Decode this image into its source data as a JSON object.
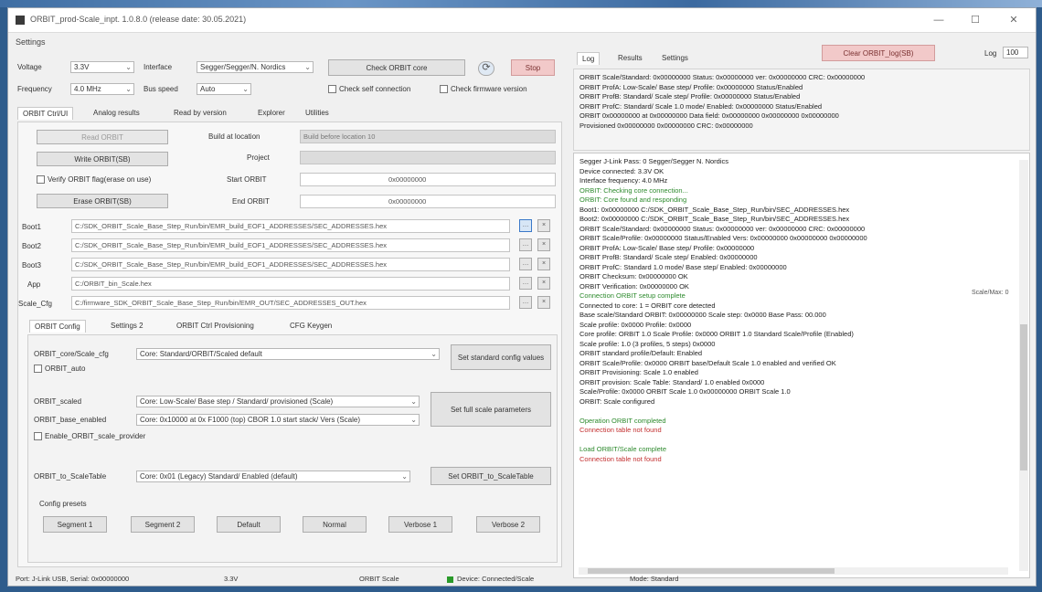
{
  "window": {
    "title": "ORBIT_prod-Scale_inpt. 1.0.8.0 (release date: 30.05.2021)",
    "controls": [
      "—",
      "☐",
      "✕"
    ]
  },
  "menu": {
    "settings": "Settings"
  },
  "top_controls": {
    "voltage_label": "Voltage",
    "voltage_value": "3.3V",
    "interface_label": "Interface",
    "interface_value": "Segger/Segger/N. Nordics",
    "frequency_label": "Frequency",
    "frequency_value": "4.0 MHz",
    "speed_label": "Bus speed",
    "speed_value": "Auto",
    "connect_button": "Check ORBIT core",
    "stop_button": "Stop",
    "refresh_icon": "refresh-icon",
    "check_a": "Check self connection",
    "check_b": "Check firmware version"
  },
  "tabs_main": [
    "ORBIT Ctrl/UI",
    "Analog results",
    "Read by version",
    "Explorer",
    "Utilities"
  ],
  "flash": {
    "read_button": "Read ORBIT",
    "write_button": "Write ORBIT(SB)",
    "verify_checkbox": "Verify ORBIT flag(erase on use)",
    "erase_button": "Erase ORBIT(SB)",
    "build_label": "Build at location",
    "build_value": "Build before location 10",
    "project_label": "Project",
    "start_label": "Start ORBIT",
    "start_value": "0x00000000",
    "end_label": "End ORBIT",
    "end_value": "0x00000000"
  },
  "files": [
    {
      "label": "Boot1",
      "value": "C:/SDK_ORBIT_Scale_Base_Step_Run/bin/EMR_build_EOF1_ADDRESSES/SEC_ADDRESSES.hex"
    },
    {
      "label": "Boot2",
      "value": "C:/SDK_ORBIT_Scale_Base_Step_Run/bin/EMR_build_EOF1_ADDRESSES/SEC_ADDRESSES.hex"
    },
    {
      "label": "Boot3",
      "value": "C:/SDK_ORBIT_Scale_Base_Step_Run/bin/EMR_build_EOF1_ADDRESSES/SEC_ADDRESSES.hex"
    },
    {
      "label": "App",
      "value": "C:/ORBIT_bin_Scale.hex"
    },
    {
      "label": "Scale_Cfg",
      "value": "C:/firmware_SDK_ORBIT_Scale_Base_Step_Run/bin/EMR_OUT/SEC_ADDRESSES_OUT.hex"
    }
  ],
  "tabs_config": [
    "ORBIT Config",
    "Settings 2",
    "ORBIT Ctrl Provisioning",
    "CFG Keygen"
  ],
  "config": {
    "row1_label": "ORBIT_core/Scale_cfg",
    "row1_value": "Core: Standard/ORBIT/Scaled default",
    "row1_check": "ORBIT_auto",
    "row1_button": "Set standard config values",
    "row2_label": "ORBIT_scaled",
    "row2_value": "Core: Low-Scale/ Base step / Standard/ provisioned (Scale)",
    "row3_label": "ORBIT_base_enabled",
    "row3_value": "Core: 0x10000 at 0x F1000 (top) CBOR 1.0 start stack/ Vers (Scale)",
    "row3_check": "Enable_ORBIT_scale_provider",
    "row23_button": "Set full scale parameters",
    "row4_label": "ORBIT_to_ScaleTable",
    "row4_value": "Core: 0x01 (Legacy) Standard/ Enabled (default)",
    "row4_button": "Set ORBIT_to_ScaleTable"
  },
  "presets": {
    "label": "Config presets",
    "buttons": [
      "Segment 1",
      "Segment 2",
      "Default",
      "Normal",
      "Verbose 1",
      "Verbose 2"
    ]
  },
  "right": {
    "tabs": [
      "Log",
      "Results",
      "Settings"
    ],
    "clear_button": "Clear ORBIT_log(SB)",
    "size_label": "Log",
    "size_value": "100",
    "summary_lines": [
      "ORBIT Scale/Standard: 0x00000000 Status: 0x00000000  ver: 0x00000000  CRC: 0x00000000",
      "   ORBIT ProfA: Low-Scale/ Base step/ Profile: 0x00000000 Status/Enabled",
      "   ORBIT ProfB: Standard/ Scale step/ Profile: 0x00000000 Status/Enabled",
      "   ORBIT ProfC: Standard/ Scale 1.0 mode/ Enabled: 0x00000000 Status/Enabled",
      "   ORBIT 0x00000000 at 0x00000000 Data field: 0x00000000  0x00000000 0x00000000",
      "Provisioned 0x00000000  0x00000000  CRC: 0x00000000"
    ],
    "log_lines": [
      {
        "t": "Segger J-Link Pass: 0 Segger/Segger N. Nordics",
        "c": ""
      },
      {
        "t": "Device connected: 3.3V OK",
        "c": ""
      },
      {
        "t": "Interface frequency: 4.0 MHz",
        "c": ""
      },
      {
        "t": "ORBIT: Checking core connection...",
        "c": "green"
      },
      {
        "t": "ORBIT: Core found and responding",
        "c": "green"
      },
      {
        "t": "Boot1: 0x00000000 C:/SDK_ORBIT_Scale_Base_Step_Run/bin/SEC_ADDRESSES.hex",
        "c": ""
      },
      {
        "t": "Boot2: 0x00000000 C:/SDK_ORBIT_Scale_Base_Step_Run/bin/SEC_ADDRESSES.hex",
        "c": ""
      },
      {
        "t": "ORBIT Scale/Standard: 0x00000000 Status: 0x00000000  ver: 0x00000000  CRC: 0x00000000",
        "c": ""
      },
      {
        "t": "ORBIT Scale/Profile: 0x00000000  Status/Enabled  Vers: 0x00000000 0x00000000 0x00000000",
        "c": ""
      },
      {
        "t": "   ORBIT ProfA: Low-Scale/ Base step/ Profile: 0x00000000",
        "c": ""
      },
      {
        "t": "   ORBIT ProfB: Standard/ Scale step/ Enabled: 0x00000000",
        "c": ""
      },
      {
        "t": "   ORBIT ProfC: Standard 1.0 mode/ Base step/ Enabled: 0x00000000",
        "c": ""
      },
      {
        "t": "ORBIT Checksum: 0x00000000 OK",
        "c": ""
      },
      {
        "t": "ORBIT Verification: 0x00000000 OK",
        "c": ""
      },
      {
        "t": "Connection ORBIT setup complete",
        "c": "green"
      },
      {
        "t": "Connected to core: 1 = ORBIT core detected",
        "c": ""
      },
      {
        "t": "Base scale/Standard ORBIT: 0x00000000 Scale step: 0x0000 Base Pass: 00.000",
        "c": ""
      },
      {
        "t": "Scale profile: 0x0000  Profile: 0x0000",
        "c": ""
      },
      {
        "t": "Core profile: ORBIT 1.0 Scale Profile: 0x0000  ORBIT 1.0 Standard Scale/Profile (Enabled)",
        "c": ""
      },
      {
        "t": "Scale profile: 1.0 (3 profiles, 5 steps)  0x0000",
        "c": ""
      },
      {
        "t": "ORBIT standard profile/Default: Enabled",
        "c": ""
      },
      {
        "t": "ORBIT Scale/Profile: 0x0000 ORBIT base/Default Scale 1.0 enabled and verified OK",
        "c": ""
      },
      {
        "t": "ORBIT Provisioning: Scale 1.0 enabled",
        "c": ""
      },
      {
        "t": "ORBIT provision: Scale Table: Standard/ 1.0 enabled  0x0000",
        "c": ""
      },
      {
        "t": "Scale/Profile: 0x0000  ORBIT Scale 1.0  0x00000000  ORBIT Scale 1.0",
        "c": ""
      },
      {
        "t": "ORBIT: Scale configured",
        "c": ""
      },
      {
        "t": "",
        "c": ""
      },
      {
        "t": "Operation ORBIT completed",
        "c": "green"
      },
      {
        "t": "Connection table not found",
        "c": "red"
      },
      {
        "t": "",
        "c": ""
      },
      {
        "t": "Load ORBIT/Scale complete",
        "c": "green"
      },
      {
        "t": "Connection table not found",
        "c": "red"
      }
    ],
    "side_value": "Scale/Max: 0"
  },
  "status": {
    "port": "Port: J-Link USB, Serial: 0x00000000",
    "voltage": "3.3V",
    "device": "ORBIT Scale",
    "connected": "Device: Connected/Scale",
    "mode": "Mode: Standard"
  }
}
